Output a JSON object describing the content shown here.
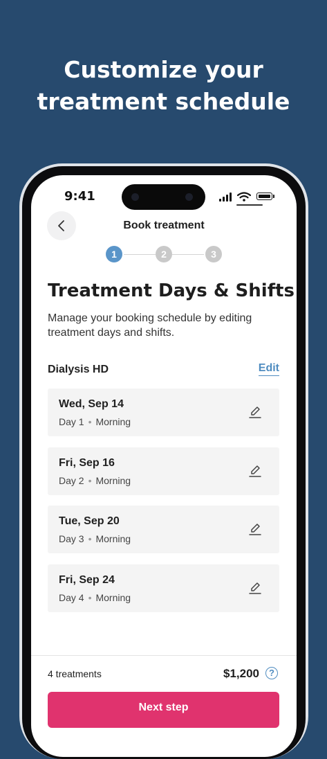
{
  "headline": {
    "line1": "Customize your",
    "line2": "treatment schedule"
  },
  "status_bar": {
    "time": "9:41"
  },
  "header": {
    "title": "Book treatment"
  },
  "stepper": {
    "steps": [
      "1",
      "2",
      "3"
    ],
    "active_step": 1,
    "active_color": "#5a95c9",
    "inactive_color": "#c9c9c9"
  },
  "main": {
    "title": "Treatment Days & Shifts",
    "subtitle": "Manage your booking schedule by editing treatment days and shifts.",
    "section_label": "Dialysis HD",
    "edit_label": "Edit",
    "treatments": [
      {
        "date": "Wed, Sep 14",
        "day": "Day 1",
        "shift": "Morning"
      },
      {
        "date": "Fri, Sep 16",
        "day": "Day 2",
        "shift": "Morning"
      },
      {
        "date": "Tue, Sep 20",
        "day": "Day 3",
        "shift": "Morning"
      },
      {
        "date": "Fri, Sep 24",
        "day": "Day 4",
        "shift": "Morning"
      }
    ]
  },
  "footer": {
    "count_label": "4 treatments",
    "price": "$1,200",
    "help_glyph": "?",
    "next_label": "Next step"
  },
  "colors": {
    "background": "#274a6e",
    "accent": "#4f8cc0",
    "primary_button": "#e0336e"
  },
  "icons": {
    "back": "chevron-left-icon",
    "edit": "pencil-icon",
    "help": "question-circle-icon"
  }
}
